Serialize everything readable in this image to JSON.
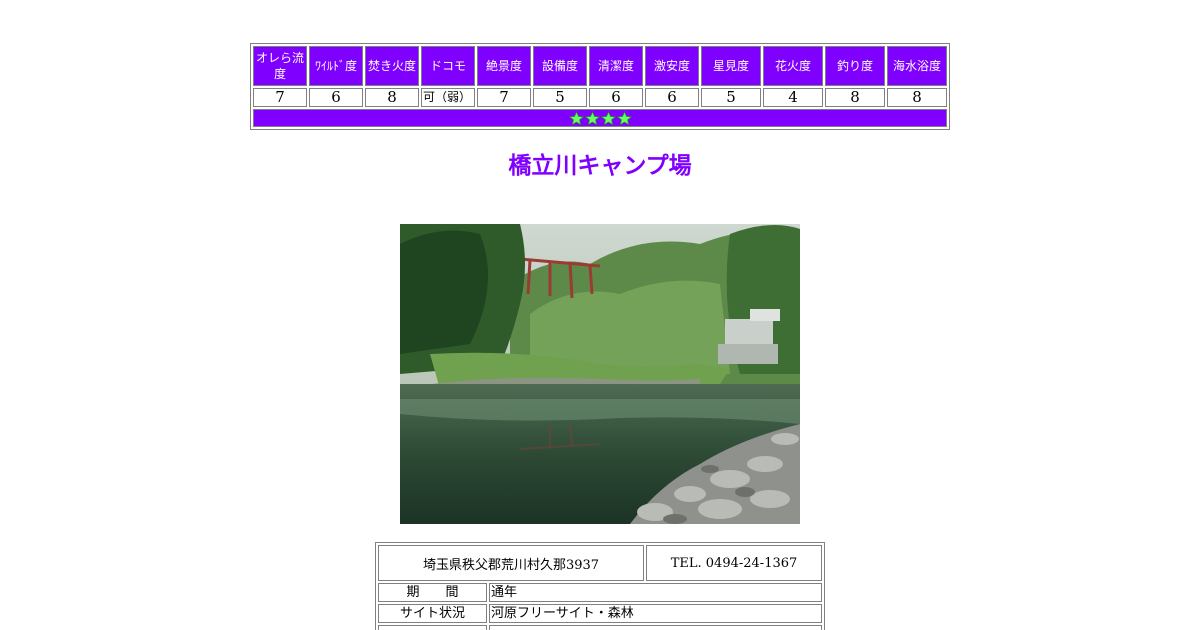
{
  "ratings": {
    "headers": [
      [
        "オレら流",
        "度"
      ],
      [
        "ﾜｲﾙﾄﾞ度"
      ],
      [
        "焚き火度"
      ],
      [
        "ドコモ"
      ],
      [
        "絶景度"
      ],
      [
        "設備度"
      ],
      [
        "清潔度"
      ],
      [
        "激安度"
      ],
      [
        "星見度"
      ],
      [
        "花火度"
      ],
      [
        "釣り度"
      ],
      [
        "海水浴度"
      ]
    ],
    "values": [
      "7",
      "6",
      "8",
      "可（弱）",
      "7",
      "5",
      "6",
      "6",
      "5",
      "4",
      "8",
      "8"
    ],
    "star_count": 4,
    "colors": {
      "header_bg": "#8000ff",
      "star_fill": "#66ff66"
    }
  },
  "title": "橋立川キャンプ場",
  "photo": {
    "icon": "river-landscape-photo"
  },
  "info": {
    "address": "埼玉県秩父郡荒川村久那3937",
    "tel": "TEL. 0494-24-1367",
    "rows": [
      {
        "label": "期　　間",
        "value": "通年"
      },
      {
        "label": "サイト状況",
        "value": "河原フリーサイト・森林"
      },
      {
        "label": "",
        "value": ""
      }
    ]
  }
}
